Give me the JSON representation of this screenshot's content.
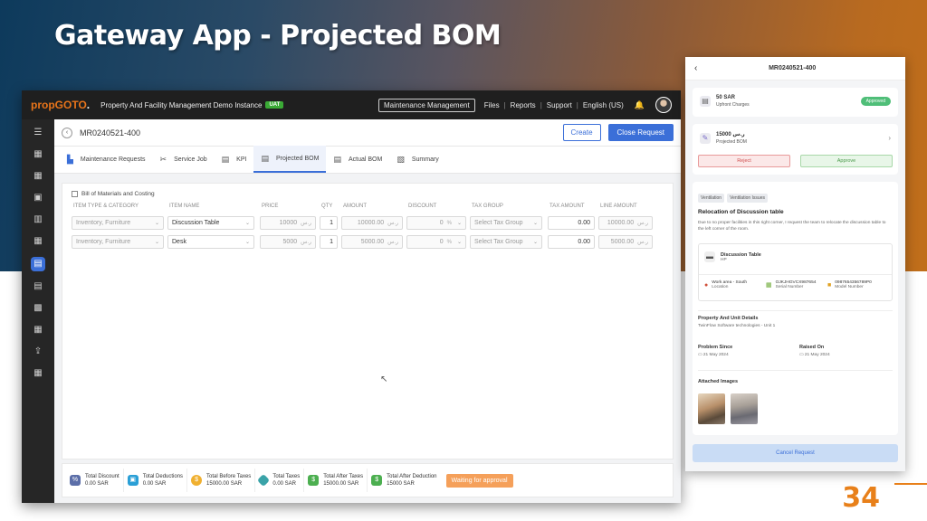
{
  "slide": {
    "title": "Gateway App - Projected BOM",
    "page_number": "34"
  },
  "web": {
    "topbar": {
      "logo_main": "propGOTO",
      "logo_dot": ".",
      "instance": "Property And Facility Management Demo Instance",
      "env_badge": "UAT",
      "module": "Maintenance Management",
      "links": [
        "Files",
        "Reports",
        "Support",
        "English (US)"
      ],
      "separator": "|"
    },
    "header": {
      "mr_id": "MR0240521-400",
      "create_label": "Create",
      "close_label": "Close Request"
    },
    "tabs": [
      {
        "label": "Maintenance Requests",
        "icon": "building-icon"
      },
      {
        "label": "Service Job",
        "icon": "tools-icon"
      },
      {
        "label": "KPI",
        "icon": "document-icon"
      },
      {
        "label": "Projected BOM",
        "icon": "list-icon",
        "active": true
      },
      {
        "label": "Actual BOM",
        "icon": "list-icon"
      },
      {
        "label": "Summary",
        "icon": "chart-icon"
      }
    ],
    "bom": {
      "title": "Bill of Materials and Costing",
      "columns": [
        "ITEM TYPE & CATEGORY",
        "ITEM NAME",
        "PRICE",
        "QTY",
        "AMOUNT",
        "DISCOUNT",
        "TAX GROUP",
        "TAX AMOUNT",
        "LINE AMOUNT"
      ],
      "currency_symbol": "ر.س",
      "percent_symbol": "%",
      "rows": [
        {
          "category": "Inventory, Furniture",
          "item": "Discussion Table",
          "price": "10000",
          "qty": "1",
          "amount": "10000.00",
          "discount": "0",
          "tax_group": "Select Tax Group",
          "tax_amount": "0.00",
          "line_amount": "10000.00"
        },
        {
          "category": "Inventory, Furniture",
          "item": "Desk",
          "price": "5000",
          "qty": "1",
          "amount": "5000.00",
          "discount": "0",
          "tax_group": "Select Tax Group",
          "tax_amount": "0.00",
          "line_amount": "5000.00"
        }
      ]
    },
    "totals": [
      {
        "label": "Total Discount",
        "value": "0.00 SAR",
        "color": "#5b6ea8"
      },
      {
        "label": "Total Deductions",
        "value": "0.00 SAR",
        "color": "#2a9fd6"
      },
      {
        "label": "Total Before Taxes",
        "value": "15000.00 SAR",
        "color": "#f0b030"
      },
      {
        "label": "Total Taxes",
        "value": "0.00 SAR",
        "color": "#3aa3a8"
      },
      {
        "label": "Total After Taxes",
        "value": "15000.00 SAR",
        "color": "#4caf50"
      },
      {
        "label": "Total After Deduction",
        "value": "15000 SAR",
        "color": "#4caf50"
      }
    ],
    "status": "Waiting for approval"
  },
  "mobile": {
    "title": "MR0240521-400",
    "upfront": {
      "amount": "50 SAR",
      "label": "Upfront Charges",
      "badge": "Approved"
    },
    "projected": {
      "amount": "15000 ر.س",
      "label": "Projected BOM",
      "reject": "Reject",
      "approve": "Approve"
    },
    "tags": [
      "Ventilation",
      "Ventilation Issues"
    ],
    "issue_title": "Relocation of Discussion table",
    "issue_desc": "Due to no proper facilities in this right corner, I request the team to relocate the discussion table to the left corner of the room.",
    "asset": {
      "name": "Discussion Table",
      "brand": "HP",
      "location_value": "Work area - South",
      "location_label": "Location",
      "serial_value": "OJKJHGVCX987654",
      "serial_label": "Serial Number",
      "model_value": "0987654356789P0",
      "model_label": "Model Number"
    },
    "property_label": "Property And Unit Details",
    "property_value": "TwinFlow Software technologies - Unit 1",
    "problem_since_label": "Problem Since",
    "problem_since_value": "21 May 2024",
    "raised_on_label": "Raised On",
    "raised_on_value": "21 May 2024",
    "attached_label": "Attached Images",
    "cancel_label": "Cancel Request"
  },
  "colors": {
    "accent": "#3b6fd8",
    "brand_orange": "#e8741a",
    "page_number": "#e8801a"
  }
}
